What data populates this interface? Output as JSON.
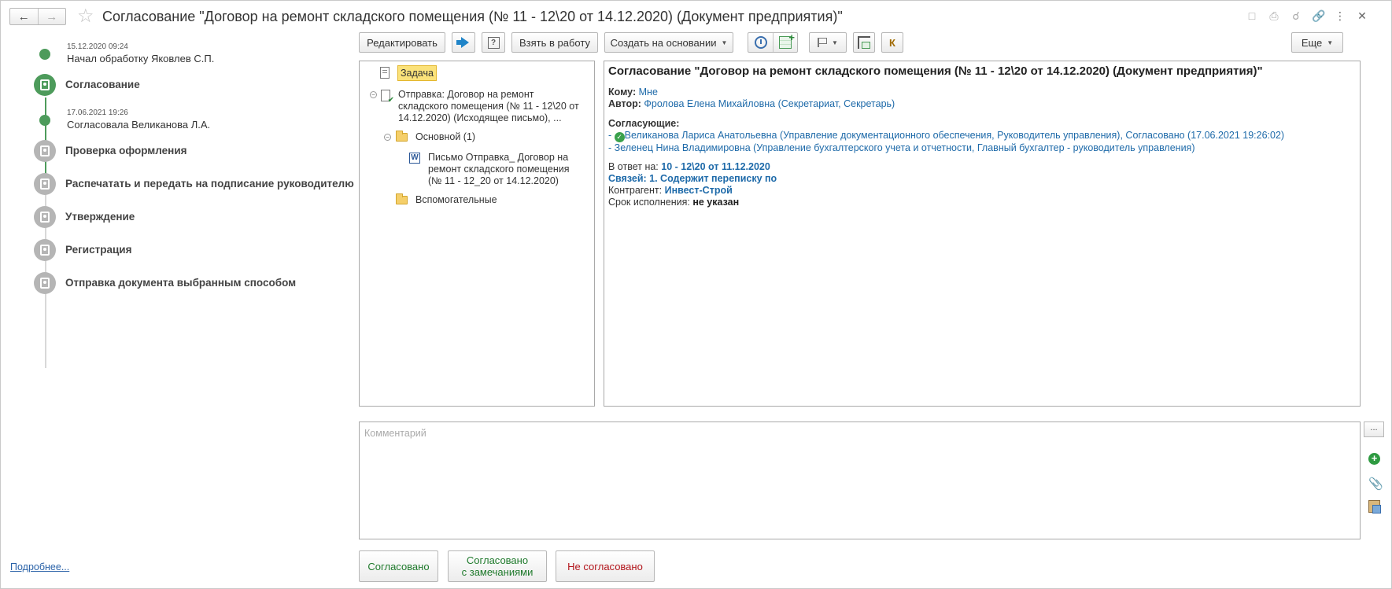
{
  "header": {
    "title": "Согласование \"Договор на ремонт складского помещения (№ 11 - 12\\20 от 14.12.2020) (Документ предприятия)\"",
    "back_icon": "arrow-left-icon",
    "forward_icon": "arrow-right-icon",
    "favorite_icon": "star-icon",
    "icons": [
      "save-icon",
      "print-icon",
      "preview-icon",
      "link-icon",
      "more-vertical-icon",
      "close-icon"
    ]
  },
  "timeline": {
    "events": [
      {
        "date": "15.12.2020 09:24",
        "text": "Начал обработку Яковлев С.П."
      },
      {
        "date": "17.06.2021 19:26",
        "text": "Согласовала Великанова Л.А."
      }
    ],
    "steps": [
      {
        "label": "Согласование",
        "status": "active"
      },
      {
        "label": "Проверка оформления",
        "status": "pending"
      },
      {
        "label": "Распечатать и передать на подписание руководителю",
        "status": "pending"
      },
      {
        "label": "Утверждение",
        "status": "pending"
      },
      {
        "label": "Регистрация",
        "status": "pending"
      },
      {
        "label": "Отправка документа выбранным способом",
        "status": "pending"
      }
    ],
    "more_link": "Подробнее..."
  },
  "toolbar": {
    "edit": "Редактировать",
    "take": "Взять в работу",
    "create_based": "Создать на основании",
    "k_label": "К",
    "more": "Еще"
  },
  "tree": {
    "task": "Задача",
    "sending": "Отправка: Договор на ремонт складского помещения (№ 11 - 12\\20 от 14.12.2020) (Исходящее письмо), ...",
    "main_folder": "Основной (1)",
    "letter": "Письмо Отправка_ Договор на ремонт складского помещения (№ 11 - 12_20 от 14.12.2020)",
    "aux_folder": "Вспомогательные"
  },
  "document": {
    "title": "Согласование \"Договор на ремонт складского помещения (№ 11 - 12\\20 от 14.12.2020) (Документ предприятия)\"",
    "to_label": "Кому:",
    "to_value": "Мне",
    "author_label": "Автор:",
    "author_value": "Фролова Елена Михайловна (Секретариат, Секретарь)",
    "approvers_label": "Согласующие:",
    "approver1": "Великанова Лариса Анатольевна (Управление документационного обеспечения, Руководитель управления), Согласовано (17.06.2021 19:26:02)",
    "approver2": "Зеленец Нина Владимировна (Управление бухгалтерского учета и отчетности, Главный бухгалтер - руководитель управления)",
    "dash": "-",
    "reply_label": "В ответ на:",
    "reply_value": "10 - 12\\20 от 11.12.2020",
    "links_label": "Связей: 1. Содержит переписку по",
    "contractor_label": "Контрагент:",
    "contractor_value": "Инвест-Строй",
    "deadline_label": "Срок исполнения:",
    "deadline_value": "не указан"
  },
  "comment": {
    "placeholder": "Комментарий",
    "dots": "..."
  },
  "actions": {
    "approved": "Согласовано",
    "approved_remarks_1": "Согласовано",
    "approved_remarks_2": "с замечаниями",
    "not_approved": "Не согласовано"
  },
  "colors": {
    "accent_green": "#4d9b5b",
    "pending_gray": "#b5b5b5",
    "link_blue": "#1e6aa9",
    "reject_red": "#b3151b"
  }
}
